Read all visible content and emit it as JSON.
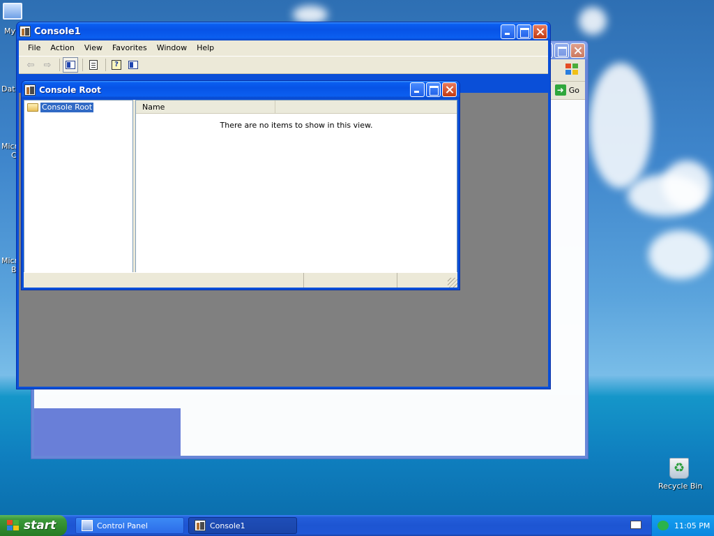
{
  "desktop": {
    "icons": [
      {
        "label": "My",
        "kind": "computer"
      },
      {
        "label": "Dat",
        "kind": "partial"
      },
      {
        "label": "Micro",
        "kind": "partial"
      },
      {
        "label": "C",
        "kind": "partial"
      },
      {
        "label": "Micro",
        "kind": "partial"
      },
      {
        "label": "B",
        "kind": "partial"
      }
    ],
    "recycle_bin": "Recycle Bin"
  },
  "control_panel_window": {
    "go_label": "Go"
  },
  "console_window": {
    "title": "Console1",
    "menus": [
      "File",
      "Action",
      "View",
      "Favorites",
      "Window",
      "Help"
    ],
    "toolbar": [
      "back-icon",
      "forward-icon",
      "show-hide-tree-icon",
      "export-list-icon",
      "help-icon",
      "show-hide-action-pane-icon"
    ]
  },
  "console_root_window": {
    "title": "Console Root",
    "tree": {
      "root_label": "Console Root"
    },
    "list": {
      "columns": [
        "Name"
      ],
      "empty_message": "There are no items to show in this view."
    }
  },
  "taskbar": {
    "start_label": "start",
    "tasks": [
      {
        "label": "Control Panel",
        "active": false
      },
      {
        "label": "Console1",
        "active": true
      }
    ],
    "clock": "11:05 PM"
  },
  "colors": {
    "title_blue": "#0a5ef0",
    "selection": "#316ac5",
    "start_green": "#3c9a3a",
    "mdi_gray": "#808080"
  }
}
